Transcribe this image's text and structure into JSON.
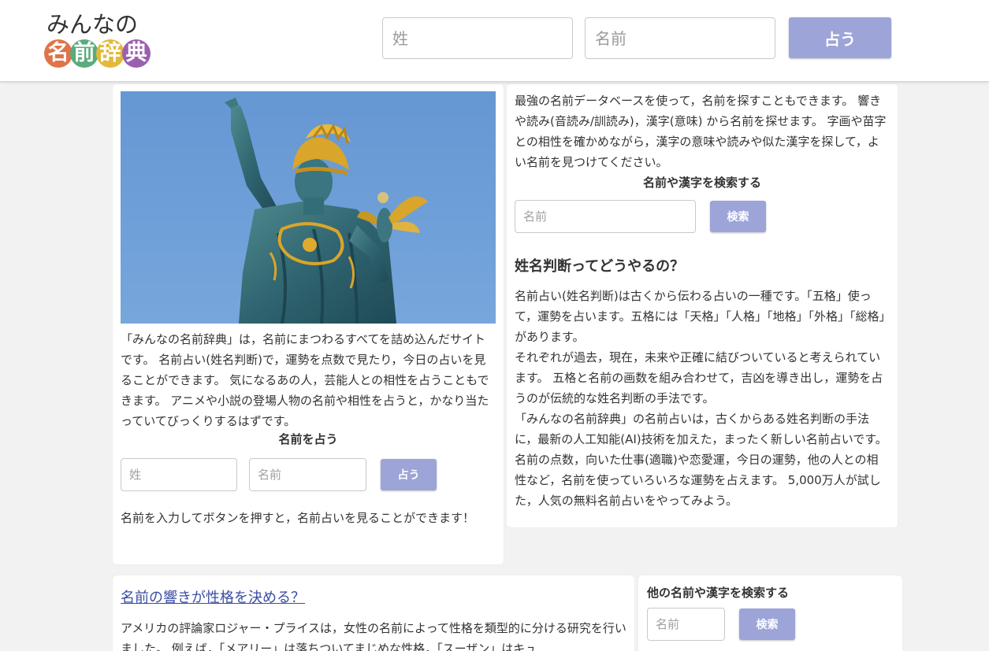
{
  "header": {
    "logo": {
      "top_text": "みんなの",
      "chars": [
        {
          "char": "名",
          "color": "#e07448"
        },
        {
          "char": "前",
          "color": "#5aab7d"
        },
        {
          "char": "辞",
          "color": "#e2b93a"
        },
        {
          "char": "典",
          "color": "#9b5fb0"
        }
      ]
    },
    "surname_placeholder": "姓",
    "given_placeholder": "名前",
    "submit_label": "占う"
  },
  "intro_card": {
    "image_name": "statue-image",
    "paragraph": "「みんなの名前辞典」は，名前にまつわるすべてを詰め込んだサイトです。 名前占い(姓名判断)で，運勢を点数で見たり，今日の占いを見ることができます。 気になるあの人，芸能人との相性を占うこともできます。 アニメや小説の登場人物の名前や相性を占うと，かなり当たっていてびっくりするはずです。",
    "form_heading": "名前を占う",
    "surname_placeholder": "姓",
    "given_placeholder": "名前",
    "submit_label": "占う",
    "footnote": "名前を入力してボタンを押すと，名前占いを見ることができます！"
  },
  "search_card": {
    "paragraph": "最強の名前データベースを使って，名前を探すこともできます。 響きや読み(音読み/訓読み)，漢字(意味) から名前を探せます。 字画や苗字との相性を確かめながら，漢字の意味や読みや似た漢字を探して，よい名前を見つけてください。",
    "form_heading": "名前や漢字を検索する",
    "input_placeholder": "名前",
    "submit_label": "検索",
    "article_heading": "姓名判断ってどうやるの？",
    "article_paragraphs": [
      "名前占い(姓名判断)は古くから伝わる占いの一種です。「五格」使って，運勢を占います。五格には「天格」「人格」「地格」「外格」「総格」があります。",
      "それぞれが過去，現在，未来や正確に結びついていると考えられています。 五格と名前の画数を組み合わせて，吉凶を導き出し，運勢を占うのが伝統的な姓名判断の手法です。",
      "「みんなの名前辞典」の名前占いは，古くからある姓名判断の手法に，最新の人工知能(AI)技術を加えた，まったく新しい名前占いです。 名前の点数，向いた仕事(適職)や恋愛運，今日の運勢，他の人との相性など，名前を使っていろいろな運勢を占えます。 5,000万人が試した，人気の無料名前占いをやってみよう。"
    ]
  },
  "article_card": {
    "title": "名前の響きが性格を決める？",
    "paragraph": "アメリカの評論家ロジャー・プライスは，女性の名前によって性格を類型的に分ける研究を行いました。 例えば，「メアリー」は落ちついてまじめな性格，「スーザン」はキュ"
  },
  "side_search": {
    "heading": "他の名前や漢字を検索する",
    "input_placeholder": "名前",
    "submit_label": "検索"
  }
}
